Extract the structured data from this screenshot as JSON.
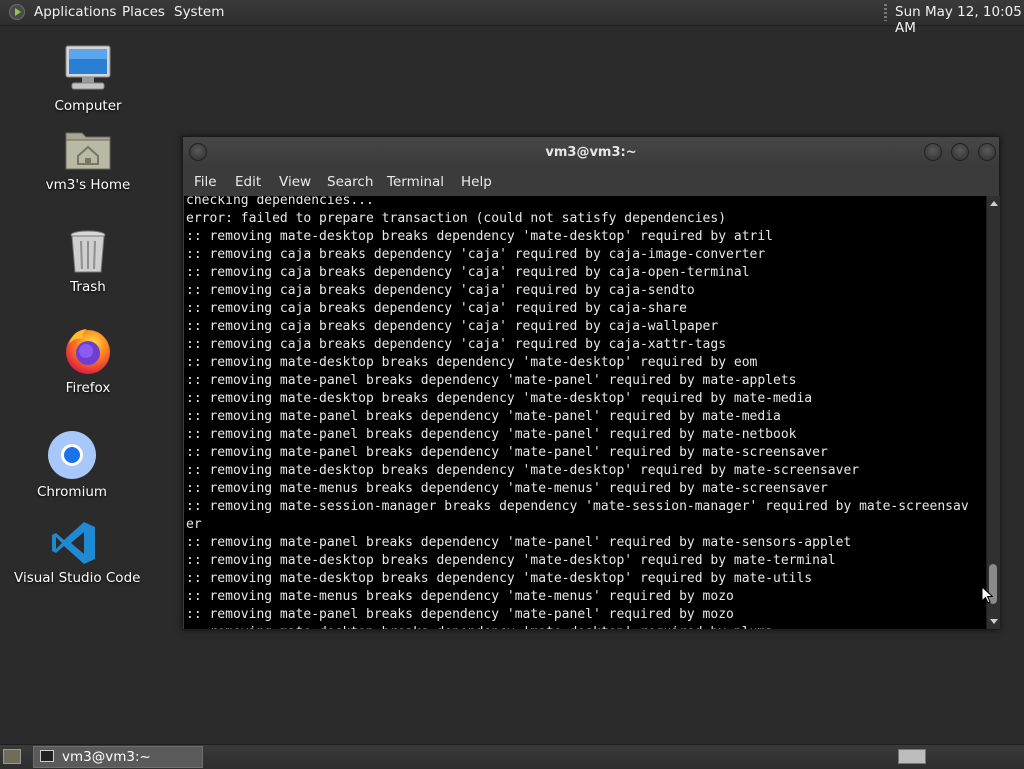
{
  "top_panel": {
    "menus": [
      "Applications",
      "Places",
      "System"
    ],
    "clock": "Sun May 12, 10:05 AM",
    "icons": [
      "mate-logo-icon"
    ]
  },
  "desktop": {
    "icons": [
      {
        "label": "Computer",
        "icon": "computer-icon"
      },
      {
        "label": "vm3's Home",
        "icon": "home-folder-icon"
      },
      {
        "label": "Trash",
        "icon": "trash-icon"
      },
      {
        "label": "Firefox",
        "icon": "firefox-icon"
      },
      {
        "label": "Chromium",
        "icon": "chromium-icon"
      },
      {
        "label": "Visual Studio Code",
        "icon": "vscode-icon"
      }
    ]
  },
  "window": {
    "title": "vm3@vm3:~",
    "menu": [
      "File",
      "Edit",
      "View",
      "Search",
      "Terminal",
      "Help"
    ],
    "scroll_fraction": 0.97,
    "lines": [
      "checking dependencies...",
      "error: failed to prepare transaction (could not satisfy dependencies)",
      ":: removing mate-desktop breaks dependency 'mate-desktop' required by atril",
      ":: removing caja breaks dependency 'caja' required by caja-image-converter",
      ":: removing caja breaks dependency 'caja' required by caja-open-terminal",
      ":: removing caja breaks dependency 'caja' required by caja-sendto",
      ":: removing caja breaks dependency 'caja' required by caja-share",
      ":: removing caja breaks dependency 'caja' required by caja-wallpaper",
      ":: removing caja breaks dependency 'caja' required by caja-xattr-tags",
      ":: removing mate-desktop breaks dependency 'mate-desktop' required by eom",
      ":: removing mate-panel breaks dependency 'mate-panel' required by mate-applets",
      ":: removing mate-desktop breaks dependency 'mate-desktop' required by mate-media",
      ":: removing mate-panel breaks dependency 'mate-panel' required by mate-media",
      ":: removing mate-panel breaks dependency 'mate-panel' required by mate-netbook",
      ":: removing mate-panel breaks dependency 'mate-panel' required by mate-screensaver",
      ":: removing mate-desktop breaks dependency 'mate-desktop' required by mate-screensaver",
      ":: removing mate-menus breaks dependency 'mate-menus' required by mate-screensaver",
      ":: removing mate-session-manager breaks dependency 'mate-session-manager' required by mate-screensav",
      "er",
      ":: removing mate-panel breaks dependency 'mate-panel' required by mate-sensors-applet",
      ":: removing mate-desktop breaks dependency 'mate-desktop' required by mate-terminal",
      ":: removing mate-desktop breaks dependency 'mate-desktop' required by mate-utils",
      ":: removing mate-menus breaks dependency 'mate-menus' required by mozo",
      ":: removing mate-panel breaks dependency 'mate-panel' required by mozo",
      ":: removing mate-desktop breaks dependency 'mate-desktop' required by pluma"
    ]
  },
  "taskbar": {
    "task_label": "vm3@vm3:~",
    "icons": [
      "show-desktop-icon",
      "terminal-icon",
      "workspace-switcher-icon"
    ]
  }
}
